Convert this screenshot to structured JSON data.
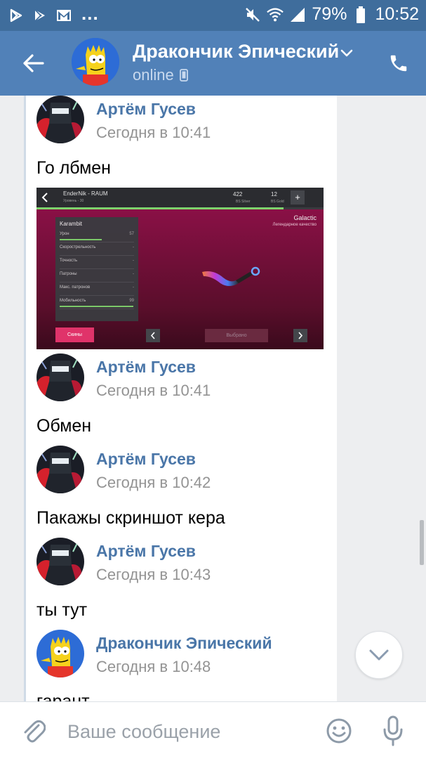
{
  "status_bar": {
    "battery_percent": "79%",
    "time": "10:52",
    "overflow": "...",
    "icons": [
      "play-store-icon",
      "play-store-icon",
      "gmail-icon",
      "mute-icon",
      "wifi-icon",
      "signal-icon",
      "battery-icon"
    ]
  },
  "header": {
    "title": "Дракончик Эпический",
    "status": "online",
    "back_icon": "arrow-left-icon",
    "call_icon": "phone-icon",
    "menu_icon": "chevron-down-icon",
    "device_icon": "mobile-icon"
  },
  "messages": [
    {
      "author": "Артём Гусев",
      "time": "Сегодня в 10:41",
      "text": "Го лбмен",
      "has_image": true
    },
    {
      "author": "Артём Гусев",
      "time": "Сегодня в 10:41",
      "text": "Обмен"
    },
    {
      "author": "Артём Гусев",
      "time": "Сегодня в 10:42",
      "text": "Пакажы скриншот кера"
    },
    {
      "author": "Артём Гусев",
      "time": "Сегодня в 10:43",
      "text": "ты тут"
    },
    {
      "author": "Дракончик Эпический",
      "time": "Сегодня в 10:48",
      "text": "гарант"
    }
  ],
  "attachment_screenshot": {
    "player_name": "EnderNik - RAUM",
    "player_level": "Уровень - 30",
    "silver_amount": "422",
    "silver_label": "BS Silver",
    "gold_amount": "12",
    "gold_label": "BS Gold",
    "plus_label": "+",
    "level_progress": 0.86,
    "weapon_name": "Karambit",
    "skin_name": "Galactic",
    "skin_quality": "Легендарное качество",
    "stats": [
      {
        "label": "Урон",
        "value": "57",
        "fill": 0.57
      },
      {
        "label": "Скорострельность",
        "value": "-",
        "fill": 0
      },
      {
        "label": "Точность",
        "value": "-",
        "fill": 0
      },
      {
        "label": "Патроны",
        "value": "-",
        "fill": 0
      },
      {
        "label": "Макс. патронов",
        "value": "-",
        "fill": 0
      },
      {
        "label": "Мобильность",
        "value": "99",
        "fill": 0.99
      }
    ],
    "skins_button": "Скины",
    "selected_button": "Выбрано"
  },
  "composer": {
    "placeholder": "Ваше сообщение",
    "attach_icon": "paperclip-icon",
    "emoji_icon": "smile-icon",
    "mic_icon": "microphone-icon"
  },
  "colors": {
    "status_bar": "#3f6d9c",
    "header": "#5181b8",
    "author_link": "#4a76a8",
    "timestamp": "#939393"
  }
}
